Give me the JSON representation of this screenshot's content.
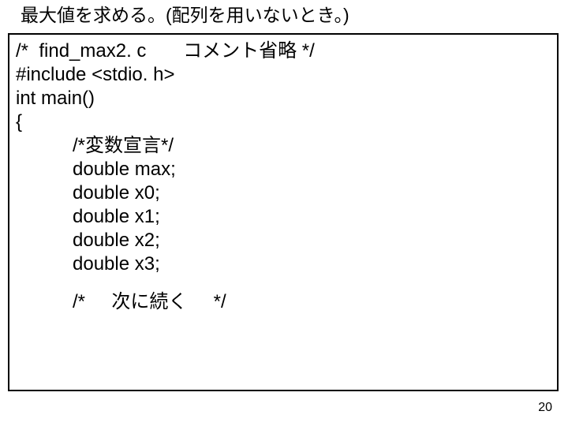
{
  "title": "最大値を求める。(配列を用いないとき。)",
  "code": {
    "l1": "/*  find_max2. c       コメント省略 */",
    "l2": "#include <stdio. h>",
    "l3": "int main()",
    "l4": "{",
    "l5": "/*変数宣言*/",
    "l6": "double max;",
    "l7": "double x0;",
    "l8": "double x1;",
    "l9": "double x2;",
    "l10": "double x3;",
    "l11": "/*     次に続く     */"
  },
  "page_number": "20"
}
